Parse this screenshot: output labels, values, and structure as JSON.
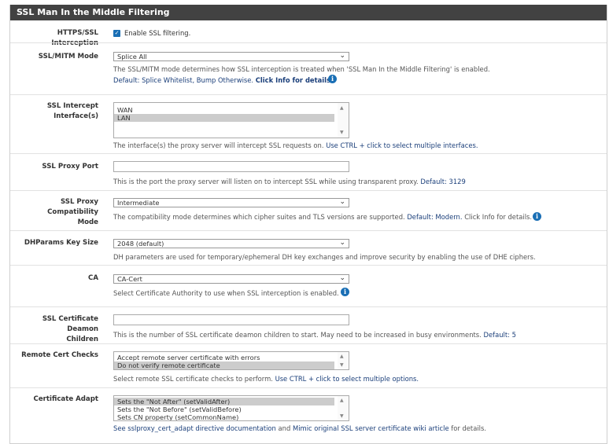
{
  "panel": {
    "title": "SSL Man In the Middle Filtering"
  },
  "colors": {
    "accent": "#1a6fb5",
    "heading_bg": "#424242",
    "link": "#1b3f7a"
  },
  "https_interception": {
    "label": "HTTPS/SSL Interception",
    "checked": true,
    "checkbox_label": "Enable SSL filtering."
  },
  "mitm_mode": {
    "label": "SSL/MITM Mode",
    "value": "Splice All",
    "help_line1": "The SSL/MITM mode determines how SSL interception is treated when 'SSL Man In the Middle Filtering' is enabled.",
    "help_default": "Default: Splice Whitelist, Bump Otherwise.",
    "help_link": "Click Info for details."
  },
  "intercept_interfaces": {
    "label": "SSL Intercept Interface(s)",
    "options": [
      "WAN",
      "LAN"
    ],
    "selected": [
      "LAN"
    ],
    "help": "The interface(s) the proxy server will intercept SSL requests on.",
    "help_link": "Use CTRL + click to select multiple interfaces."
  },
  "proxy_port": {
    "label": "SSL Proxy Port",
    "value": "",
    "help": "This is the port the proxy server will listen on to intercept SSL while using transparent proxy.",
    "help_default": "Default: 3129"
  },
  "compat_mode": {
    "label_line1": "SSL Proxy Compatibility",
    "label_line2": "Mode",
    "value": "Intermediate",
    "help": "The compatibility mode determines which cipher suites and TLS versions are supported.",
    "help_default": "Default: Modern.",
    "help_tail": "Click Info for details."
  },
  "dhparams": {
    "label": "DHParams Key Size",
    "value": "2048 (default)",
    "help": "DH parameters are used for temporary/ephemeral DH key exchanges and improve security by enabling the use of DHE ciphers."
  },
  "ca": {
    "label": "CA",
    "value": "CA-Cert",
    "help": "Select Certificate Authority to use when SSL interception is enabled."
  },
  "cert_daemon": {
    "label_line1": "SSL Certificate Deamon",
    "label_line2": "Children",
    "value": "",
    "help": "This is the number of SSL certificate deamon children to start. May need to be increased in busy environments.",
    "help_default": "Default: 5"
  },
  "remote_cert": {
    "label": "Remote Cert Checks",
    "options": [
      "Accept remote server certificate with errors",
      "Do not verify remote certificate"
    ],
    "selected": [
      "Do not verify remote certificate"
    ],
    "help": "Select remote SSL certificate checks to perform.",
    "help_link": "Use CTRL + click to select multiple options."
  },
  "cert_adapt": {
    "label": "Certificate Adapt",
    "options": [
      "Sets the \"Not After\" (setValidAfter)",
      "Sets the \"Not Before\" (setValidBefore)",
      "Sets CN property (setCommonName)"
    ],
    "selected": [
      "Sets the \"Not After\" (setValidAfter)"
    ],
    "help_link1": "See sslproxy_cert_adapt directive documentation",
    "help_and": "and",
    "help_link2": "Mimic original SSL server certificate wiki article",
    "help_tail": "for details."
  }
}
